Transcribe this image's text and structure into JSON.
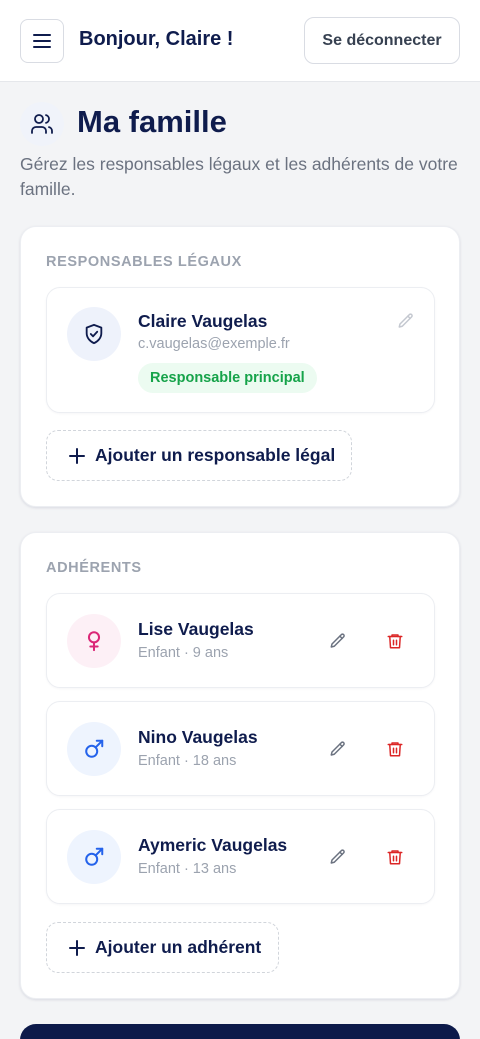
{
  "header": {
    "greeting": "Bonjour, Claire !",
    "logout_label": "Se déconnecter"
  },
  "page": {
    "title": "Ma famille",
    "subtitle": "Gérez les responsables légaux et les adhérents de votre famille."
  },
  "responsables": {
    "label": "RESPONSABLES LÉGAUX",
    "items": [
      {
        "name": "Claire Vaugelas",
        "email": "c.vaugelas@exemple.fr",
        "badge": "Responsable principal",
        "icon": "shield-check-icon"
      }
    ],
    "add_label": "Ajouter un responsable légal"
  },
  "adherents": {
    "label": "ADHÉRENTS",
    "items": [
      {
        "name": "Lise Vaugelas",
        "meta": "Enfant · 9 ans",
        "icon": "female-icon"
      },
      {
        "name": "Nino Vaugelas",
        "meta": "Enfant · 18 ans",
        "icon": "male-icon"
      },
      {
        "name": "Aymeric Vaugelas",
        "meta": "Enfant · 13 ans",
        "icon": "male-icon"
      }
    ],
    "add_label": "Ajouter un adhérent"
  },
  "colors": {
    "navy": "#0f1c4d",
    "badge_green": "#16a34a",
    "delete_red": "#dc2626",
    "female_pink": "#db2777",
    "male_blue": "#2563eb"
  }
}
